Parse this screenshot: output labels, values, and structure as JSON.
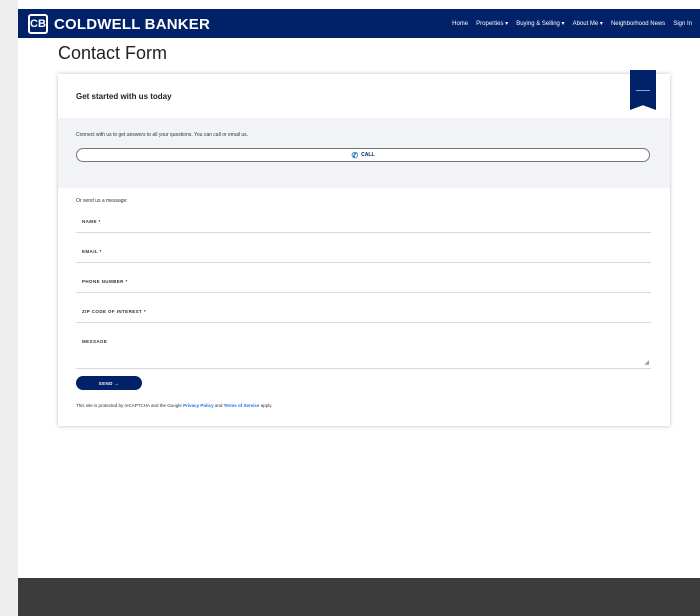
{
  "header": {
    "brand": "COLDWELL BANKER",
    "logo_mark": "CB",
    "nav": [
      {
        "label": "Home"
      },
      {
        "label": "Properties ▾"
      },
      {
        "label": "Buying & Selling ▾"
      },
      {
        "label": "About Me ▾"
      },
      {
        "label": "Neighborhood News"
      },
      {
        "label": "Sign In"
      }
    ]
  },
  "page": {
    "title": "Contact Form"
  },
  "card": {
    "title": "Get started with us today",
    "call_prompt": "Connect with us to get answers to all your questions. You can call or email us.",
    "call_button": "CALL",
    "message_prompt": "Or send us a message:",
    "fields": [
      {
        "label": "NAME *"
      },
      {
        "label": "EMAIL *"
      },
      {
        "label": "PHONE NUMBER *"
      },
      {
        "label": "ZIP CODE OF INTEREST *"
      },
      {
        "label": "MESSAGE"
      }
    ],
    "send_button": "SEND →",
    "recaptcha": {
      "prefix": "This site is protected by reCAPTCHA and the Google ",
      "privacy": "Privacy Policy",
      "and": " and ",
      "terms": "Terms of Service",
      "suffix": " apply."
    }
  },
  "colors": {
    "brand": "#012169",
    "link": "#1a73e8"
  },
  "icons": {
    "call": "phone-icon",
    "ribbon": "bookmark-ribbon-icon"
  }
}
